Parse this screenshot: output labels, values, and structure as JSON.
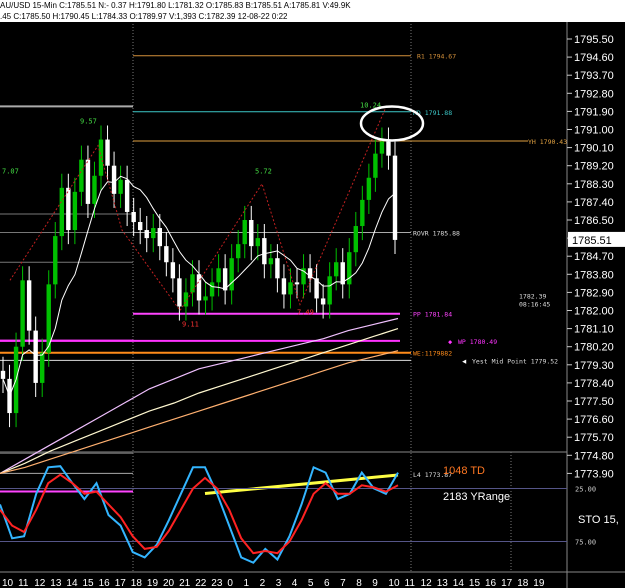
{
  "header": {
    "line1": "AU/USD 15-Min  C:1785.51  N:- 0.37  H:1791.80  L:1781.32  O:1785.83  B:1785.51  A:1785.81  V:49.9K",
    "line2": ".45  C:1785.50  H:1790.45  L:1784.33  O:1789.97  V:1,393  C:1782.39  12-08-22  0:22"
  },
  "price_axis": {
    "labels": [
      "1795.50",
      "1794.60",
      "1793.70",
      "1792.80",
      "1791.90",
      "1791.00",
      "1790.10",
      "1789.20",
      "1788.30",
      "1787.40",
      "1786.50",
      "1785.60",
      "1784.70",
      "1783.80",
      "1782.90",
      "1782.00",
      "1781.10",
      "1780.20",
      "1779.30",
      "1778.40",
      "1777.50",
      "1776.60",
      "1775.70",
      "1774.80",
      "1773.90"
    ],
    "current": "1785.51"
  },
  "time_axis": {
    "labels": [
      "10",
      "11",
      "12",
      "13",
      "14",
      "15",
      "16",
      "17",
      "18",
      "19",
      "20",
      "21",
      "22",
      "23",
      "0",
      "1",
      "2",
      "3",
      "4",
      "5",
      "6",
      "7",
      "8",
      "9",
      "10",
      "11",
      "12",
      "13",
      "14",
      "15",
      "16",
      "17",
      "18",
      "19"
    ]
  },
  "levels": {
    "r1": "R1 1794.67",
    "hd": "HD 1791.88",
    "yh": "YH 1790.43",
    "rovr": "ROVR 1785.88",
    "pp": "PP 1781.84",
    "wp": "WP 1780.49",
    "we": "WE:1179882",
    "ymid": "Yest Mid Point 1779.52",
    "l4": "L4 1773.87",
    "cursor_price": "1782.39",
    "cursor_time": "08:16:45"
  },
  "swing_labels": [
    "7.07",
    "9.57",
    "5.72",
    "10.24",
    "9.11",
    "7.49"
  ],
  "stochastic": {
    "td": "1048 TD",
    "yrange": "2183 YRange",
    "name": "STO  15,",
    "upper": "25.00",
    "lower": "75.00"
  },
  "colors": {
    "up": "#00c000",
    "down": "#ffffff",
    "r1": "#d4903a",
    "hd": "#3cc8c8",
    "yh": "#e0a040",
    "pp": "#ff44ff",
    "wp": "#ff33ff",
    "we": "#ff8c1a",
    "l4": "#ffff44",
    "td": "#ff7722",
    "sto_fast": "#33b5ff",
    "sto_slow": "#ff2222"
  },
  "chart_data": {
    "type": "candlestick",
    "title": "AU/USD 15-Min",
    "ylim": [
      1772.9,
      1796.6
    ],
    "levels": [
      {
        "name": "R1",
        "value": 1794.67
      },
      {
        "name": "HD",
        "value": 1791.88
      },
      {
        "name": "YH",
        "value": 1790.43
      },
      {
        "name": "ROVR",
        "value": 1785.88
      },
      {
        "name": "PP",
        "value": 1781.84
      },
      {
        "name": "WP",
        "value": 1780.49
      },
      {
        "name": "Yest Mid Point",
        "value": 1779.52
      },
      {
        "name": "L4",
        "value": 1773.87
      }
    ],
    "close": [
      1778.6,
      1776.9,
      1780.2,
      1783.5,
      1781.0,
      1778.4,
      1779.9,
      1783.3,
      1785.7,
      1788.1,
      1786.0,
      1787.9,
      1789.5,
      1787.3,
      1788.7,
      1790.5,
      1789.2,
      1787.8,
      1788.5,
      1786.9,
      1786.4,
      1786.0,
      1785.6,
      1786.1,
      1785.2,
      1784.4,
      1783.6,
      1782.2,
      1782.9,
      1783.8,
      1782.5,
      1782.7,
      1783.4,
      1784.1,
      1783.0,
      1784.6,
      1785.3,
      1786.5,
      1785.2,
      1785.6,
      1784.3,
      1784.6,
      1783.6,
      1782.8,
      1783.4,
      1783.3,
      1784.1,
      1783.6,
      1782.6,
      1782.3,
      1783.7,
      1784.4,
      1783.3,
      1784.9,
      1786.2,
      1787.5,
      1788.6,
      1789.8,
      1790.4,
      1789.7,
      1785.51
    ],
    "series": [
      {
        "name": "upper band",
        "values": [
          1773.9,
          1774.6,
          1775.3,
          1776.0,
          1776.7,
          1777.4,
          1778.1,
          1778.6,
          1779.1,
          1779.4,
          1779.7,
          1780.0,
          1780.3,
          1780.6,
          1781.0,
          1781.3,
          1781.6
        ]
      },
      {
        "name": "mid band",
        "values": [
          1773.9,
          1774.4,
          1775.0,
          1775.5,
          1776.0,
          1776.5,
          1777.0,
          1777.4,
          1777.9,
          1778.3,
          1778.7,
          1779.1,
          1779.5,
          1779.9,
          1780.3,
          1780.7,
          1781.1
        ]
      },
      {
        "name": "lower band",
        "values": [
          1773.9,
          1774.2,
          1774.6,
          1775.0,
          1775.4,
          1775.8,
          1776.2,
          1776.6,
          1777.0,
          1777.4,
          1777.8,
          1778.2,
          1778.6,
          1779.0,
          1779.4,
          1779.7,
          1780.0
        ]
      },
      {
        "name": "sto_fast",
        "values": [
          40,
          72,
          70,
          30,
          5,
          4,
          20,
          35,
          20,
          50,
          60,
          85,
          90,
          78,
          55,
          30,
          5,
          5,
          30,
          60,
          90,
          95,
          82,
          92,
          70,
          40,
          5,
          10,
          35,
          30,
          10,
          25,
          30,
          10
        ]
      },
      {
        "name": "sto_slow",
        "values": [
          45,
          60,
          66,
          45,
          20,
          12,
          20,
          30,
          28,
          40,
          52,
          70,
          82,
          80,
          65,
          45,
          25,
          15,
          25,
          45,
          72,
          86,
          84,
          86,
          75,
          55,
          30,
          20,
          30,
          30,
          22,
          24,
          28,
          22
        ]
      }
    ]
  }
}
